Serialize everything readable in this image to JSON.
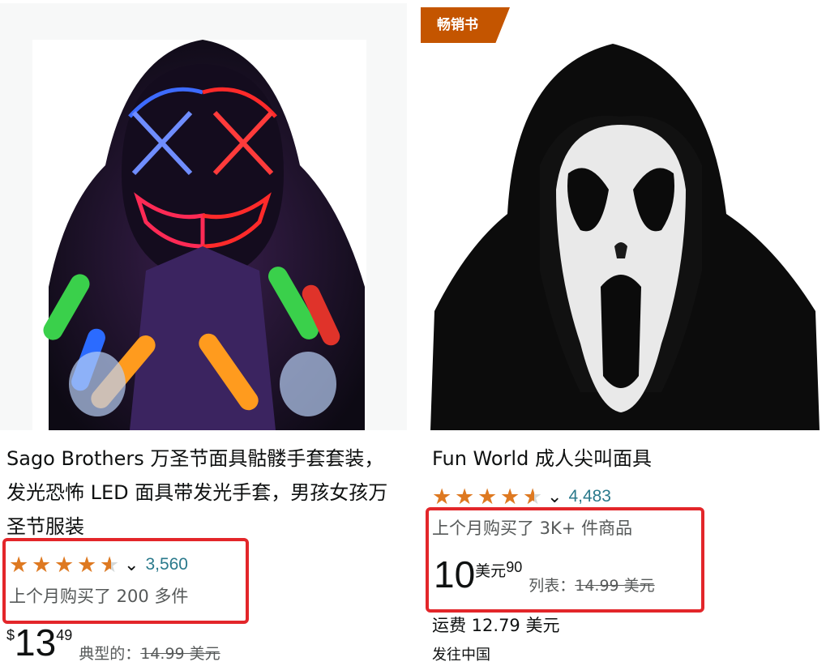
{
  "products": [
    {
      "badge": "",
      "title": "Sago Brothers 万圣节面具骷髅手套套装，发光恐怖 LED 面具带发光手套，男孩女孩万圣节服装",
      "rating_value": 4.5,
      "review_count": "3,560",
      "bought_text": "上个月购买了 200 多件",
      "price_symbol": "$",
      "price_whole": "13",
      "price_fraction": "49",
      "typical_label": "典型的：",
      "typical_price": "14.99 美元",
      "image_icon": "led-purge-mask-with-glowing-gloves"
    },
    {
      "badge": "畅销书",
      "title": "Fun World 成人尖叫面具",
      "rating_value": 4.5,
      "review_count": "4,483",
      "bought_text": "上个月购买了 3K+ 件商品",
      "price_whole": "10",
      "price_currency": "美元",
      "price_fraction": "90",
      "list_label": "列表：",
      "list_price": "14.99 美元",
      "shipping": "运费 12.79 美元",
      "ships_to": "发往中国",
      "image_icon": "ghostface-scream-mask"
    }
  ],
  "ui": {
    "star_full": "★",
    "chevron": "⌄",
    "highlight_color": "#e3262a",
    "star_color": "#de7921",
    "badge_color": "#c45500",
    "link_color": "#2b7a8c"
  }
}
